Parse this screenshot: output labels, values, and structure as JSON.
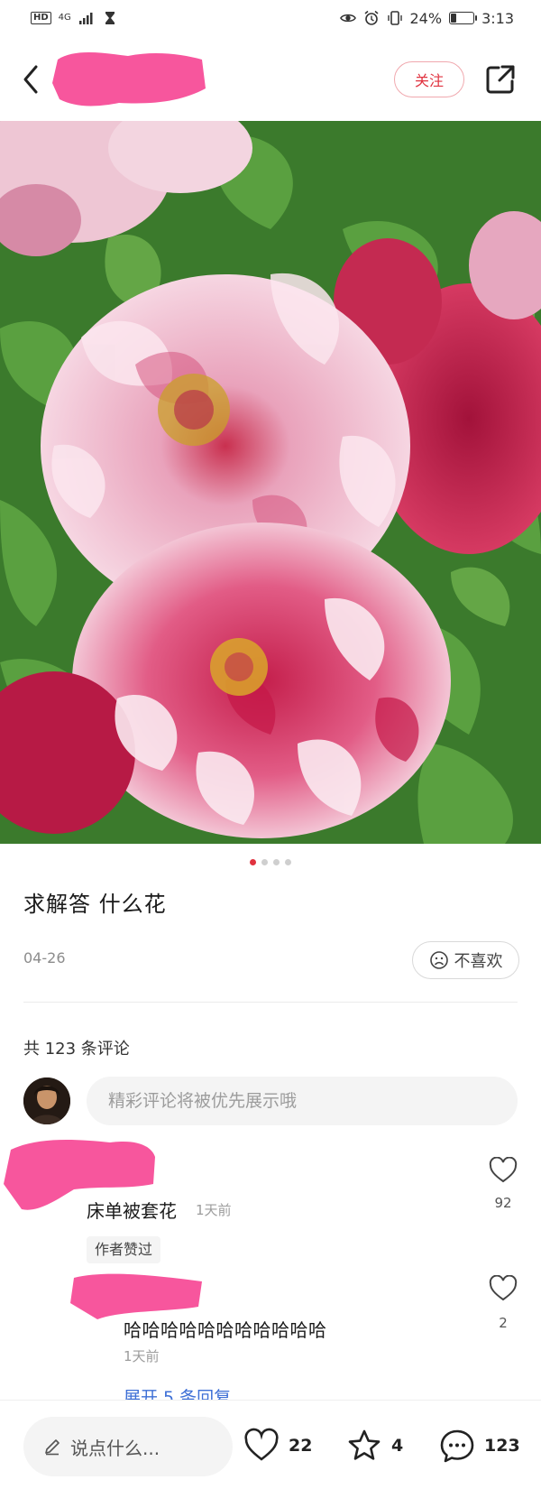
{
  "status_bar": {
    "hd": "HD",
    "network": "4G",
    "battery": "24%",
    "battery_level": 0.24,
    "time": "3:13"
  },
  "header": {
    "follow_label": "关注"
  },
  "gallery": {
    "image_count": 4,
    "current_index": 1
  },
  "post": {
    "title": "求解答 什么花",
    "date": "04-26",
    "dislike_label": "不喜欢"
  },
  "comments": {
    "count_label": "共 123 条评论",
    "input_placeholder": "精彩评论将被优先展示哦",
    "items": [
      {
        "text": "床单被套花",
        "time": "1天前",
        "badge": "作者赞过",
        "likes": "92"
      },
      {
        "text": "哈哈哈哈哈哈哈哈哈哈哈",
        "time": "1天前",
        "likes": "2",
        "expand_label": "展开 5 条回复"
      }
    ]
  },
  "bottom_bar": {
    "input_placeholder": "说点什么...",
    "like_count": "22",
    "star_count": "4",
    "comment_count": "123"
  },
  "colors": {
    "accent_red": "#e0323f",
    "link_blue": "#3d6fd6",
    "redaction_pink": "#f7569d"
  }
}
